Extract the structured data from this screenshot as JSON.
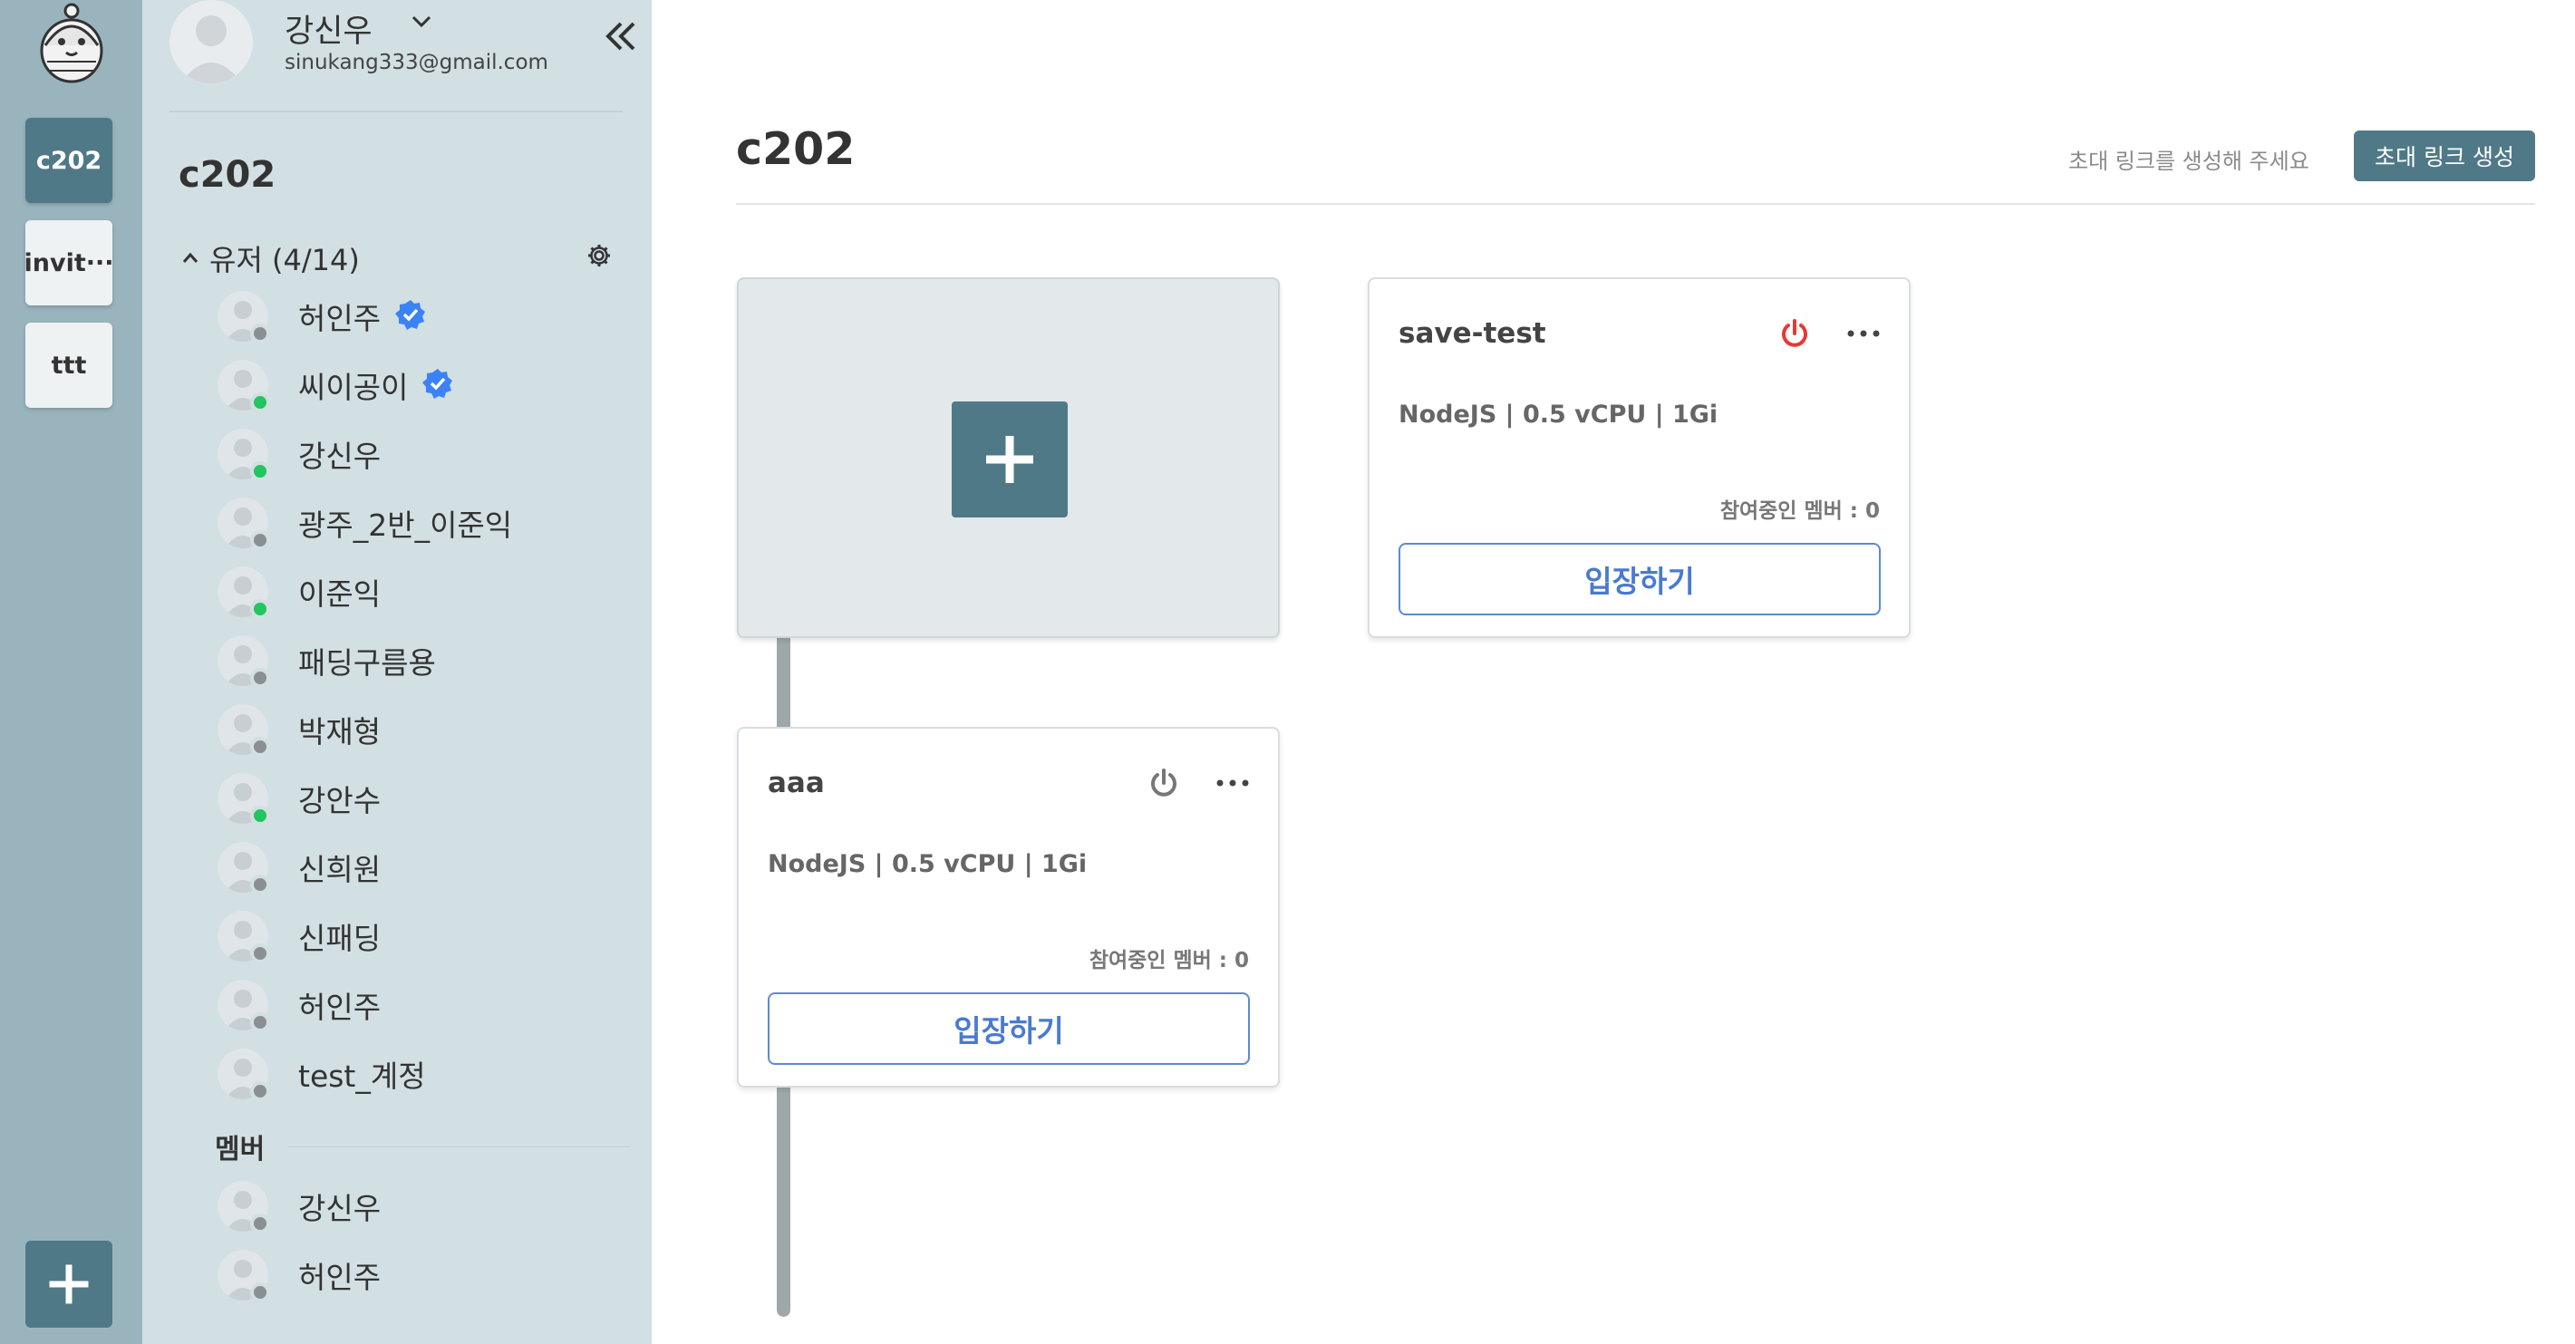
{
  "rail": {
    "servers": [
      {
        "label": "c202",
        "active": true
      },
      {
        "label": "invit···",
        "active": false
      },
      {
        "label": "ttt",
        "active": false
      }
    ]
  },
  "profile": {
    "name": "강신우",
    "email": "sinukang333@gmail.com"
  },
  "sidebar": {
    "server_name": "c202",
    "group_label": "유저 (4/14)",
    "users": [
      {
        "name": "허인주",
        "status": "offline",
        "verified": true
      },
      {
        "name": "씨이공이",
        "status": "online",
        "verified": true
      },
      {
        "name": "강신우",
        "status": "online",
        "verified": false
      },
      {
        "name": "광주_2반_이준익",
        "status": "offline",
        "verified": false
      },
      {
        "name": "이준익",
        "status": "online",
        "verified": false
      },
      {
        "name": "패딩구름용",
        "status": "offline",
        "verified": false
      },
      {
        "name": "박재형",
        "status": "offline",
        "verified": false
      },
      {
        "name": "강안수",
        "status": "online",
        "verified": false
      },
      {
        "name": "신희원",
        "status": "offline",
        "verified": false
      },
      {
        "name": "신패딩",
        "status": "offline",
        "verified": false
      },
      {
        "name": "허인주",
        "status": "offline",
        "verified": false
      },
      {
        "name": "test_계정",
        "status": "offline",
        "verified": false
      }
    ],
    "members_label": "멤버",
    "members": [
      {
        "name": "강신우",
        "status": "offline"
      },
      {
        "name": "허인주",
        "status": "offline"
      }
    ]
  },
  "main": {
    "title": "c202",
    "invite_hint": "초대 링크를 생성해 주세요",
    "invite_button": "초대 링크 생성",
    "containers": [
      {
        "name": "save-test",
        "spec": "NodeJS | 0.5 vCPU | 1Gi",
        "members": "참여중인 멤버 : 0",
        "enter": "입장하기",
        "running": true
      },
      {
        "name": "aaa",
        "spec": "NodeJS | 0.5 vCPU | 1Gi",
        "members": "참여중인 멤버 : 0",
        "enter": "입장하기",
        "running": false
      }
    ]
  },
  "colors": {
    "accent": "#4f7987",
    "online": "#22c55e",
    "offline": "#8a8f93",
    "verified": "#3b82f6",
    "power_on": "#e53935",
    "power_off": "#777777",
    "enter_blue": "#4a7ad0"
  }
}
